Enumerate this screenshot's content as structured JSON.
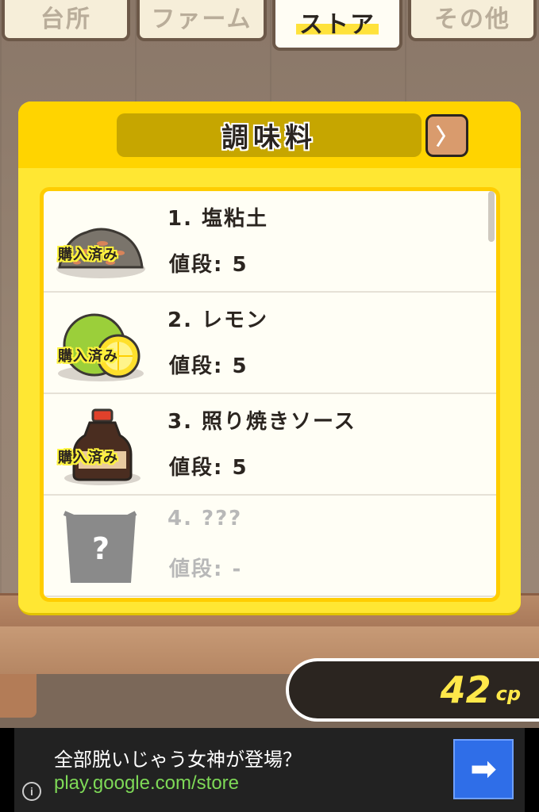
{
  "tabs": [
    {
      "label": "台所",
      "active": false
    },
    {
      "label": "ファーム",
      "active": false
    },
    {
      "label": "ストア",
      "active": true
    },
    {
      "label": "その他",
      "active": false
    }
  ],
  "panel": {
    "title": "調味料",
    "next_icon": "chevron-right-icon",
    "next_label": "〉"
  },
  "items": [
    {
      "name": "1. 塩粘土",
      "price": "値段: 5",
      "status": "購入済み",
      "icon": "salt-clay-icon"
    },
    {
      "name": "2. レモン",
      "price": "値段: 5",
      "status": "購入済み",
      "icon": "lemon-icon"
    },
    {
      "name": "3. 照り焼きソース",
      "price": "値段: 5",
      "status": "購入済み",
      "icon": "teriyaki-sauce-icon"
    },
    {
      "name": "4. ???",
      "price": "値段: -",
      "status": "",
      "icon": "mystery-bag-icon"
    }
  ],
  "currency": {
    "value": "42",
    "unit": "cp"
  },
  "ad": {
    "title": "全部脱いじゃう女神が登場？",
    "url": "play.google.com/store",
    "button_label": "➡",
    "info_label": "i"
  },
  "colors": {
    "panel_yellow": "#ffe733",
    "header_yellow": "#ffd400",
    "title_bar": "#c6a600",
    "next_button": "#d99b6d",
    "currency_text": "#ffe84a",
    "ad_button": "#2f6ee8",
    "ad_url": "#7ed957"
  }
}
